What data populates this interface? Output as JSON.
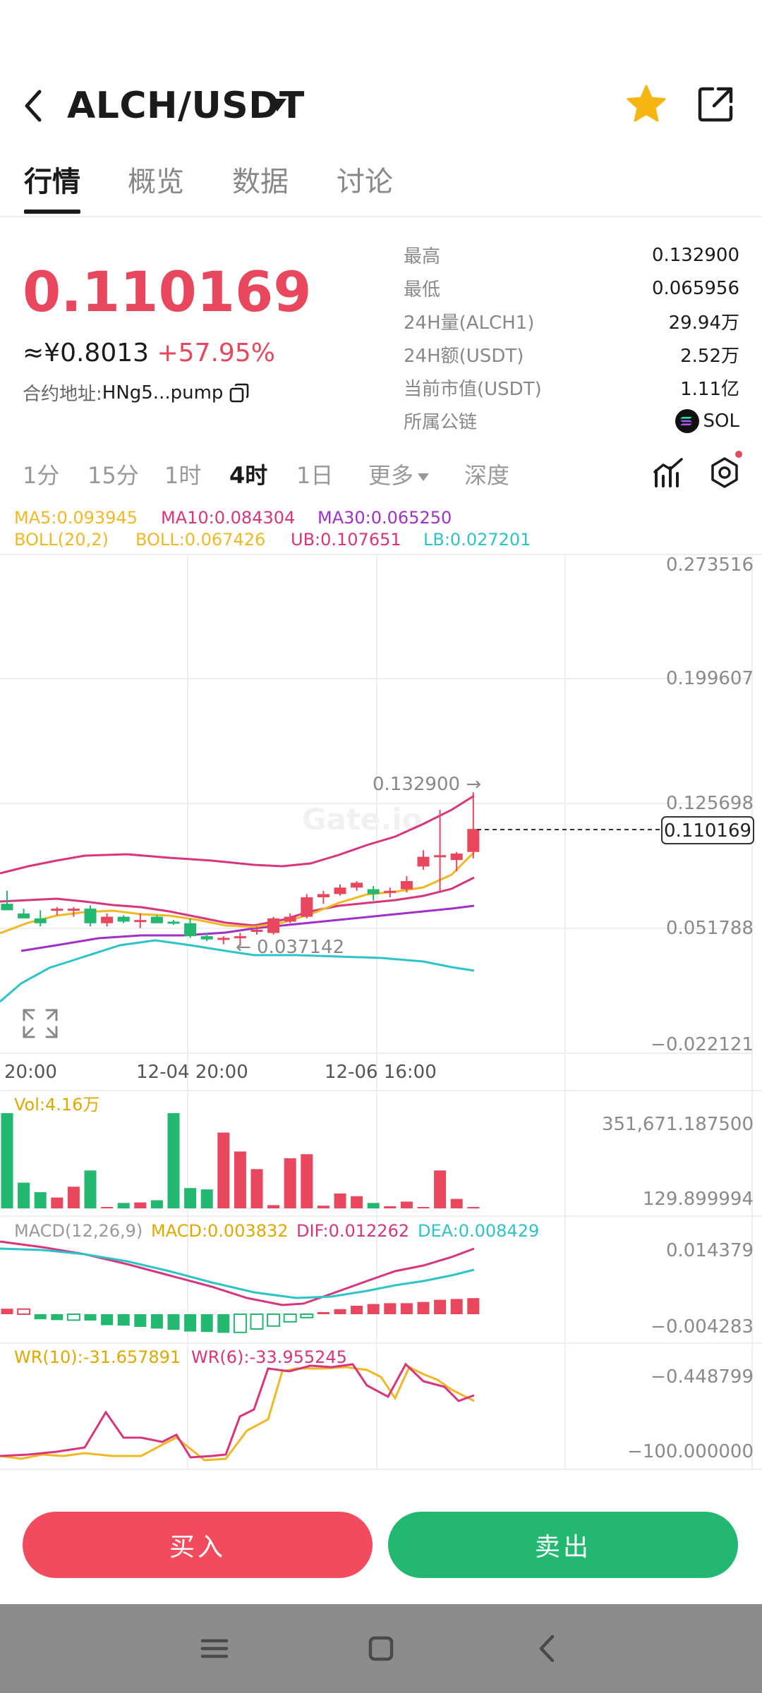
{
  "header": {
    "pair": "ALCH/USDT",
    "icons": [
      "back-icon",
      "caret-down-icon",
      "star-icon",
      "share-icon"
    ]
  },
  "tabs": [
    "行情",
    "概览",
    "数据",
    "讨论"
  ],
  "active_tab": "行情",
  "price": {
    "last": "0.110169",
    "cny": "≈¥0.8013",
    "change": "+57.95%",
    "contract_label": "合约地址:",
    "contract_addr": "HNg5...pump"
  },
  "stats": [
    {
      "label": "最高",
      "value": "0.132900"
    },
    {
      "label": "最低",
      "value": "0.065956"
    },
    {
      "label": "24H量(ALCH1)",
      "value": "29.94万"
    },
    {
      "label": "24H额(USDT)",
      "value": "2.52万"
    },
    {
      "label": "当前市值(USDT)",
      "value": "1.11亿"
    },
    {
      "label": "所属公链",
      "value": "SOL"
    }
  ],
  "intervals": [
    "1分",
    "15分",
    "1时",
    "4时",
    "1日",
    "更多",
    "深度"
  ],
  "active_interval": "4时",
  "indicators": {
    "ma5": "MA5:0.093945",
    "ma10": "MA10:0.084304",
    "ma30": "MA30:0.065250",
    "boll": "BOLL(20,2)",
    "boll_val": "BOLL:0.067426",
    "ub": "UB:0.107651",
    "lb": "LB:0.027201",
    "vol": "Vol:4.16万",
    "macd_label": "MACD(12,26,9)",
    "macd": "MACD:0.003832",
    "dif": "DIF:0.012262",
    "dea": "DEA:0.008429",
    "wr10": "WR(10):-31.657891",
    "wr6": "WR(6):-33.955245"
  },
  "axes": {
    "price_ticks": [
      "0.273516",
      "0.199607",
      "0.125698",
      "0.051788",
      "−0.022121"
    ],
    "time_ticks": [
      "20:00",
      "12-04 20:00",
      "12-06 16:00"
    ],
    "vol_ticks": [
      "351,671.187500",
      "129.899994"
    ],
    "macd_ticks": [
      "0.014379",
      "−0.004283"
    ],
    "wr_ticks": [
      "−0.448799",
      "−100.000000"
    ],
    "high_marker": "0.132900 →",
    "low_marker": "← 0.037142",
    "current_price_tag": "0.110169",
    "watermark": "Gate.io"
  },
  "colors": {
    "up": "#e8475d",
    "down": "#22b870",
    "ma5": "#f2b824",
    "ma10": "#d8357d",
    "ma30": "#a030c8",
    "lb": "#2cc4c8"
  },
  "chart_data": [
    {
      "type": "candlestick",
      "title": "",
      "ylim": [
        -0.022121,
        0.273516
      ],
      "x": [
        "20:00",
        "12-04 20:00",
        "12-06 16:00"
      ],
      "candles": [
        {
          "o": 0.064,
          "h": 0.072,
          "l": 0.06,
          "c": 0.06
        },
        {
          "o": 0.058,
          "h": 0.061,
          "l": 0.055,
          "c": 0.055
        },
        {
          "o": 0.055,
          "h": 0.06,
          "l": 0.05,
          "c": 0.052
        },
        {
          "o": 0.06,
          "h": 0.062,
          "l": 0.057,
          "c": 0.061
        },
        {
          "o": 0.06,
          "h": 0.062,
          "l": 0.056,
          "c": 0.061
        },
        {
          "o": 0.061,
          "h": 0.063,
          "l": 0.05,
          "c": 0.052
        },
        {
          "o": 0.052,
          "h": 0.058,
          "l": 0.05,
          "c": 0.056
        },
        {
          "o": 0.056,
          "h": 0.057,
          "l": 0.052,
          "c": 0.053
        },
        {
          "o": 0.053,
          "h": 0.058,
          "l": 0.049,
          "c": 0.054
        },
        {
          "o": 0.056,
          "h": 0.057,
          "l": 0.052,
          "c": 0.052
        },
        {
          "o": 0.053,
          "h": 0.054,
          "l": 0.051,
          "c": 0.052
        },
        {
          "o": 0.052,
          "h": 0.055,
          "l": 0.043,
          "c": 0.044
        },
        {
          "o": 0.044,
          "h": 0.046,
          "l": 0.041,
          "c": 0.042
        },
        {
          "o": 0.042,
          "h": 0.044,
          "l": 0.039,
          "c": 0.043
        },
        {
          "o": 0.043,
          "h": 0.046,
          "l": 0.038,
          "c": 0.044
        },
        {
          "o": 0.047,
          "h": 0.05,
          "l": 0.045,
          "c": 0.048
        },
        {
          "o": 0.046,
          "h": 0.056,
          "l": 0.045,
          "c": 0.055
        },
        {
          "o": 0.053,
          "h": 0.058,
          "l": 0.052,
          "c": 0.056
        },
        {
          "o": 0.056,
          "h": 0.07,
          "l": 0.055,
          "c": 0.068
        },
        {
          "o": 0.068,
          "h": 0.072,
          "l": 0.064,
          "c": 0.07
        },
        {
          "o": 0.07,
          "h": 0.076,
          "l": 0.069,
          "c": 0.074
        },
        {
          "o": 0.074,
          "h": 0.078,
          "l": 0.072,
          "c": 0.077
        },
        {
          "o": 0.073,
          "h": 0.075,
          "l": 0.066,
          "c": 0.07
        },
        {
          "o": 0.071,
          "h": 0.074,
          "l": 0.068,
          "c": 0.072
        },
        {
          "o": 0.073,
          "h": 0.081,
          "l": 0.071,
          "c": 0.078
        },
        {
          "o": 0.087,
          "h": 0.097,
          "l": 0.085,
          "c": 0.093
        },
        {
          "o": 0.094,
          "h": 0.122,
          "l": 0.072,
          "c": 0.094
        },
        {
          "o": 0.091,
          "h": 0.096,
          "l": 0.084,
          "c": 0.095
        },
        {
          "o": 0.096,
          "h": 0.1329,
          "l": 0.092,
          "c": 0.110169
        }
      ],
      "volume": [
        351671,
        95000,
        60000,
        40000,
        80000,
        140000,
        5000,
        20000,
        22000,
        30000,
        351671,
        75000,
        70000,
        280000,
        210000,
        145000,
        12000,
        185000,
        200000,
        10000,
        55000,
        45000,
        20000,
        8000,
        25000,
        1000,
        140000,
        35000,
        129.9
      ],
      "macd_hist": [
        0.0013,
        0.0012,
        -0.0012,
        -0.0014,
        -0.0014,
        -0.0015,
        -0.0026,
        -0.0027,
        -0.003,
        -0.0034,
        -0.0037,
        -0.0041,
        -0.0042,
        -0.0044,
        -0.0043,
        -0.0035,
        -0.0028,
        -0.0018,
        -0.0008,
        0.0002,
        0.0012,
        0.002,
        0.0024,
        0.0026,
        0.0026,
        0.0029,
        0.0034,
        0.0036,
        0.0038
      ]
    }
  ],
  "actions": {
    "buy": "买入",
    "sell": "卖出"
  }
}
